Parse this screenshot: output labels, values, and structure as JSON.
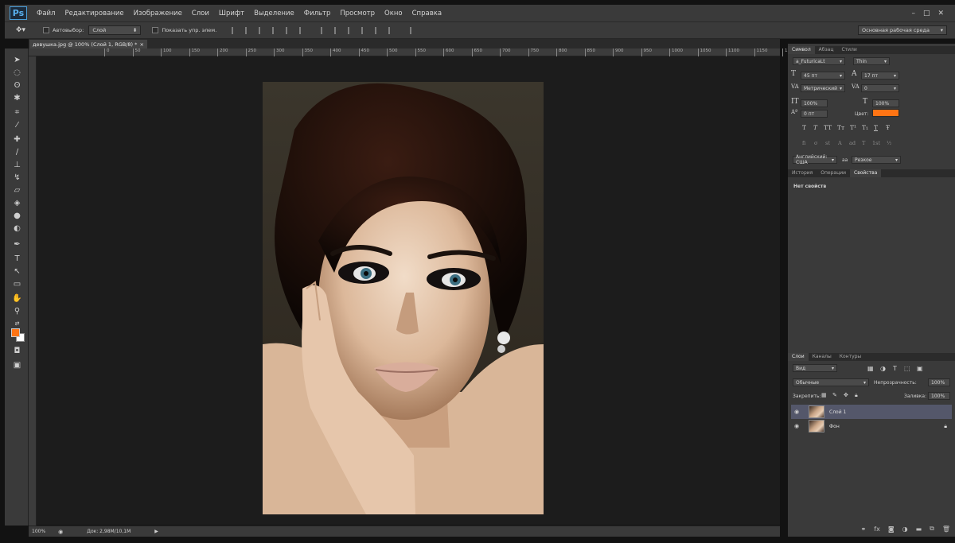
{
  "app": {
    "logo": "Ps",
    "window_controls": [
      "–",
      "□",
      "✕"
    ]
  },
  "menu": [
    "Файл",
    "Редактирование",
    "Изображение",
    "Слои",
    "Шрифт",
    "Выделение",
    "Фильтр",
    "Просмотр",
    "Окно",
    "Справка"
  ],
  "options": {
    "autoselect_label": "Автовыбор:",
    "autoselect_value": "Слой",
    "show_controls_label": "Показать упр. элем.",
    "workspace": "Основная рабочая среда"
  },
  "document": {
    "tab_title": "девушка.jpg @ 100% (Слой 1, RGB/8) *",
    "tab_close": "×"
  },
  "ruler": {
    "ticks": [
      "0",
      "50",
      "100",
      "150",
      "200",
      "250",
      "300",
      "350",
      "400",
      "450",
      "500",
      "550",
      "600",
      "650",
      "700",
      "750",
      "800",
      "850",
      "900",
      "950",
      "1000",
      "1050",
      "1100",
      "1150",
      "1200",
      "1250",
      "1300",
      "1350"
    ]
  },
  "status": {
    "zoom": "100%",
    "doc_size": "Док: 2,98M/10,1M"
  },
  "character_panel": {
    "tabs": [
      "Символ",
      "Абзац",
      "Стили"
    ],
    "font_family": "a_FuturicaLt",
    "font_style": "Thin",
    "size": "45 пт",
    "leading": "17 пт",
    "kerning": "Метрический",
    "tracking": "0",
    "vscale": "100%",
    "hscale": "100%",
    "baseline": "0 пт",
    "color_label": "Цвет:",
    "color": "#ff7414",
    "style_buttons": [
      "T",
      "T",
      "TT",
      "Tт",
      "T¹",
      "T₁",
      "T",
      "Ŧ"
    ],
    "opentype_buttons": [
      "fi",
      "σ",
      "st",
      "A",
      "ad",
      "T",
      "1st",
      "½"
    ],
    "language": "Английский: США",
    "aa_label": "aa",
    "antialias": "Резкое"
  },
  "props_panel": {
    "tabs": [
      "История",
      "Операции",
      "Свойства"
    ],
    "empty": "Нет свойств"
  },
  "layers_panel": {
    "tabs": [
      "Слои",
      "Каналы",
      "Контуры"
    ],
    "filter": "Вид",
    "blend_mode": "Обычные",
    "opacity_label": "Непрозрачность:",
    "opacity": "100%",
    "lock_label": "Закрепить:",
    "fill_label": "Заливка:",
    "fill": "100%",
    "layers": [
      {
        "name": "Слой 1",
        "selected": true
      },
      {
        "name": "Фон",
        "selected": false
      }
    ]
  }
}
